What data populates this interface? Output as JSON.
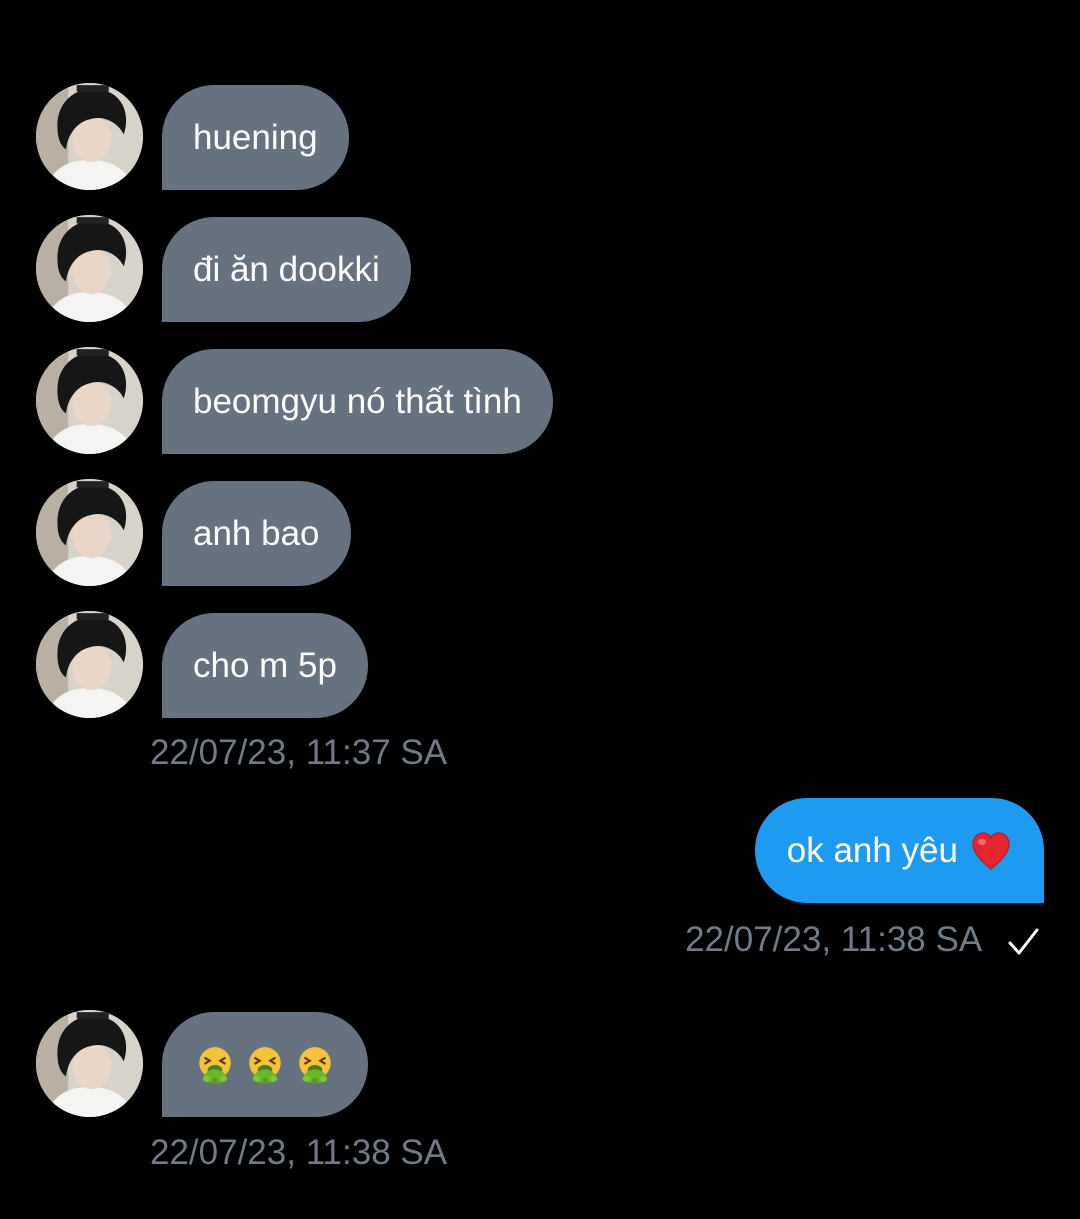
{
  "conversation": {
    "incoming_group_1": {
      "messages": [
        {
          "text": "huening"
        },
        {
          "text": "đi ăn dookki"
        },
        {
          "text": "beomgyu nó thất tình"
        },
        {
          "text": "anh bao"
        },
        {
          "text": "cho m 5p"
        }
      ],
      "timestamp": "22/07/23, 11:37 SA"
    },
    "outgoing": {
      "text": "ok anh yêu",
      "emoji_icon": "red-heart-icon",
      "timestamp": "22/07/23, 11:38 SA",
      "status_icon": "checkmark-icon"
    },
    "incoming_group_2": {
      "message_emoji_icons": [
        "vomiting-face-icon",
        "vomiting-face-icon",
        "vomiting-face-icon"
      ],
      "timestamp": "22/07/23, 11:38 SA"
    }
  },
  "colors": {
    "background": "#000000",
    "incoming_bubble": "#66727f",
    "outgoing_bubble": "#1d9bf0",
    "timestamp_text": "#6f7b88",
    "message_text": "#ffffff"
  }
}
